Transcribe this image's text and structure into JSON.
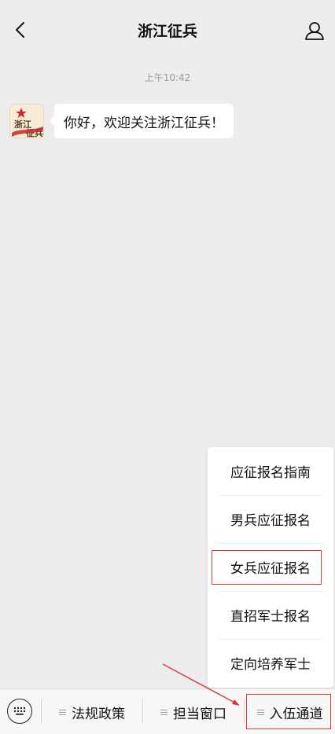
{
  "header": {
    "title": "浙江征兵",
    "back_icon": "chevron-left-icon",
    "profile_icon": "person-icon"
  },
  "chat": {
    "timestamp": "上午10:42",
    "messages": [
      {
        "text": "你好，欢迎关注浙江征兵！",
        "avatar_text": "浙江征兵"
      }
    ]
  },
  "popup_menu": {
    "items": [
      {
        "label": "应征报名指南"
      },
      {
        "label": "男兵应征报名"
      },
      {
        "label": "女兵应征报名"
      },
      {
        "label": "直招军士报名"
      },
      {
        "label": "定向培养军士"
      }
    ],
    "highlighted_item": "女兵应征报名"
  },
  "bottom_menu": {
    "keyboard_icon": "keyboard-icon",
    "items": [
      {
        "label": "法规政策"
      },
      {
        "label": "担当窗口"
      },
      {
        "label": "入伍通道"
      }
    ],
    "highlighted_item": "入伍通道"
  },
  "colors": {
    "background": "#ededed",
    "bubble": "#ffffff",
    "highlight_border": "#d9393a",
    "annotation_arrow": "#d9393a"
  }
}
